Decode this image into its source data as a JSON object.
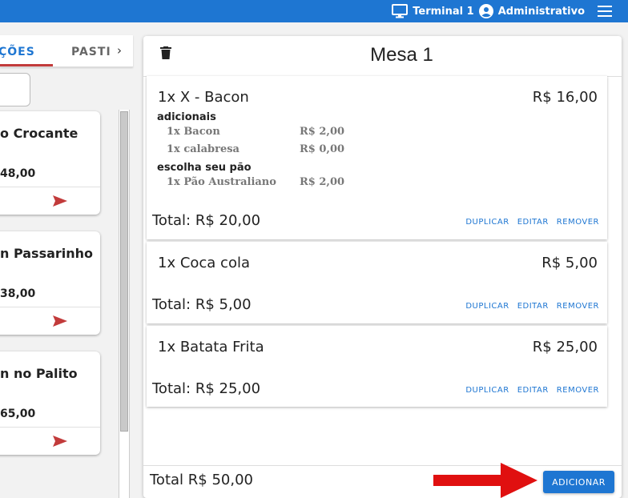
{
  "topbar": {
    "terminal_label": "Terminal 1",
    "user_label": "Administrativo",
    "icons": {
      "terminal": "monitor-icon",
      "user": "account-circle-icon",
      "menu": "hamburger-menu-icon"
    }
  },
  "left": {
    "tabs": [
      {
        "label": "ÇÕES",
        "active": true
      },
      {
        "label": "PASTI",
        "active": false
      }
    ],
    "tab_next": "›",
    "products": [
      {
        "name": "o Crocante",
        "price": "48,00"
      },
      {
        "name": "n Passarinho",
        "price": "38,00"
      },
      {
        "name": "n no Palito",
        "price": "65,00"
      }
    ]
  },
  "order": {
    "title": "Mesa 1",
    "items": [
      {
        "name": "1x X - Bacon",
        "price": "R$ 16,00",
        "groups": [
          {
            "title": "adicionais",
            "options": [
              {
                "name": "1x Bacon",
                "price": "R$ 2,00"
              },
              {
                "name": "1x calabresa",
                "price": "R$ 0,00"
              }
            ]
          },
          {
            "title": "escolha seu pão",
            "options": [
              {
                "name": "1x Pão Australiano",
                "price": "R$ 2,00"
              }
            ]
          }
        ],
        "total": "Total: R$ 20,00"
      },
      {
        "name": "1x Coca cola",
        "price": "R$ 5,00",
        "total": "Total: R$ 5,00"
      },
      {
        "name": "1x Batata Frita",
        "price": "R$ 25,00",
        "total": "Total: R$ 25,00"
      }
    ],
    "actions": {
      "duplicate": "DUPLICAR",
      "edit": "EDITAR",
      "remove": "REMOVER"
    },
    "grand_total": "Total R$ 50,00",
    "add_button": "ADICIONAR"
  },
  "colors": {
    "primary": "#1e76d2",
    "accent_red": "#c23b3b",
    "arrow_red": "#e01010"
  }
}
